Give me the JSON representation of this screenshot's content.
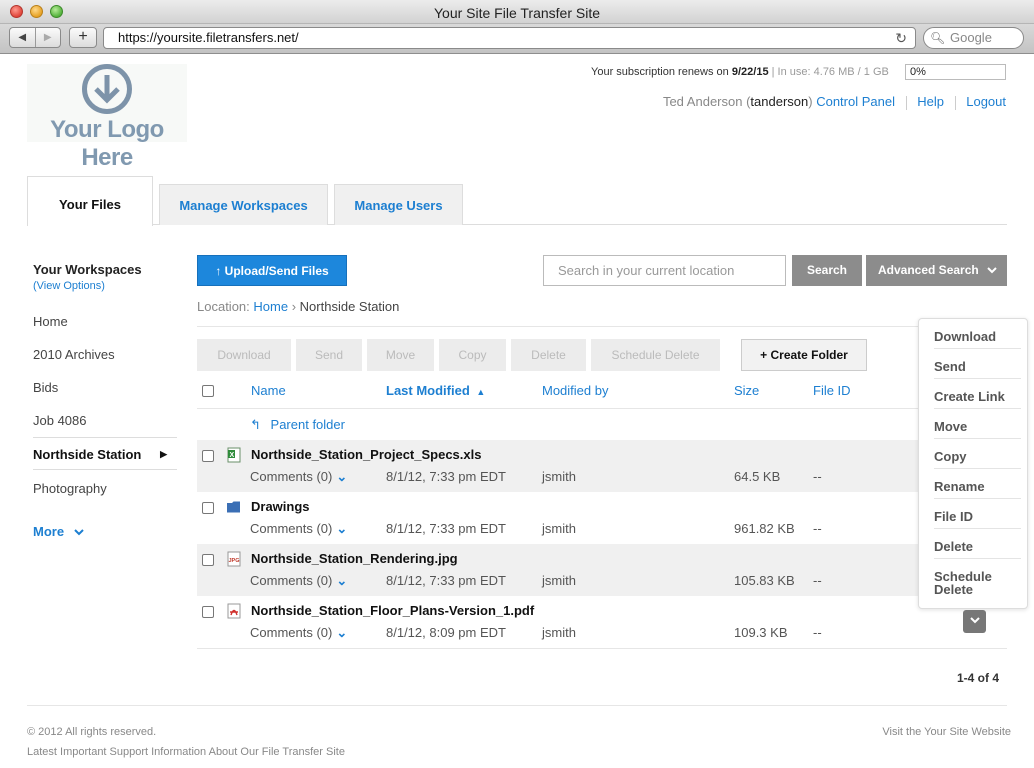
{
  "window": {
    "title": "Your Site File Transfer Site"
  },
  "browser": {
    "url": "https://yoursite.filetransfers.net/",
    "search_placeholder": "Google"
  },
  "logo": {
    "text": "Your Logo Here"
  },
  "subscription": {
    "renews_label": "Your subscription renews on",
    "renews_date": "9/22/15",
    "in_use_label": "In use:",
    "in_use_value": "4.76 MB",
    "quota": "/ 1 GB",
    "percent": "0%"
  },
  "user": {
    "name": "Ted Anderson",
    "username": "tanderson",
    "links": [
      "Control Panel",
      "Help",
      "Logout"
    ]
  },
  "tabs": [
    "Your Files",
    "Manage Workspaces",
    "Manage Users"
  ],
  "sidebar": {
    "title": "Your Workspaces",
    "view_options": "(View Options)",
    "items": [
      "Home",
      "2010 Archives",
      "Bids",
      "Job 4086",
      "Northside Station",
      "Photography"
    ],
    "active_index": 4,
    "more": "More"
  },
  "toolbar": {
    "upload_label": "Upload/Send Files",
    "search_placeholder": "Search in your current location",
    "search_label": "Search",
    "advanced_label": "Advanced Search"
  },
  "location": {
    "label": "Location:",
    "home": "Home",
    "separator": "›",
    "current": "Northside Station"
  },
  "actions": [
    "Download",
    "Send",
    "Move",
    "Copy",
    "Delete",
    "Schedule Delete"
  ],
  "create_folder": "+ Create Folder",
  "columns": {
    "name": "Name",
    "modified": "Last Modified",
    "modified_by": "Modified by",
    "size": "Size",
    "file_id": "File ID"
  },
  "parent_folder": "Parent folder",
  "files": [
    {
      "name": "Northside_Station_Project_Specs.xls",
      "icon": "excel-file-icon",
      "comments": "Comments (0)",
      "modified": "8/1/12, 7:33 pm EDT",
      "by": "jsmith",
      "size": "64.5 KB",
      "file_id": "--"
    },
    {
      "name": "Drawings",
      "icon": "folder-icon",
      "comments": "Comments (0)",
      "modified": "8/1/12, 7:33 pm EDT",
      "by": "jsmith",
      "size": "961.82 KB",
      "file_id": "--"
    },
    {
      "name": "Northside_Station_Rendering.jpg",
      "icon": "jpg-file-icon",
      "comments": "Comments (0)",
      "modified": "8/1/12, 7:33 pm EDT",
      "by": "jsmith",
      "size": "105.83 KB",
      "file_id": "--"
    },
    {
      "name": "Northside_Station_Floor_Plans-Version_1.pdf",
      "icon": "pdf-file-icon",
      "comments": "Comments (0)",
      "modified": "8/1/12, 8:09 pm EDT",
      "by": "jsmith",
      "size": "109.3 KB",
      "file_id": "--"
    }
  ],
  "context_menu": [
    "Download",
    "Send",
    "Create Link",
    "Move",
    "Copy",
    "Rename",
    "File ID",
    "Delete",
    "Schedule Delete"
  ],
  "paging": "1-4 of 4",
  "footer": {
    "copyright": "© 2012 All rights reserved.",
    "support": "Latest Important Support Information About Our File Transfer Site",
    "visit": "Visit the Your Site Website"
  },
  "colors": {
    "accent": "#1d87dc",
    "link": "#1d7fd1",
    "button_gray": "#8c8c8c"
  }
}
